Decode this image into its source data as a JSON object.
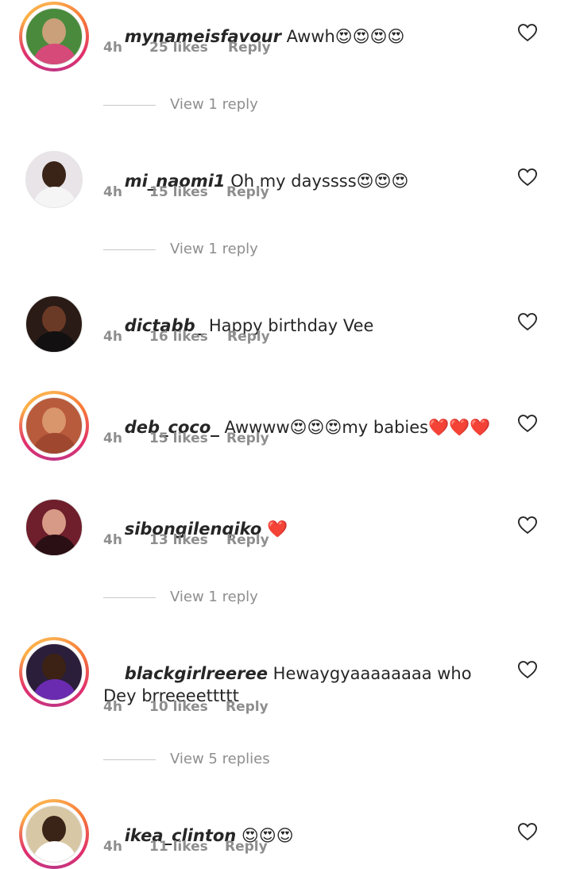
{
  "comments": [
    {
      "username": "mynameisfavour",
      "text": " Awwh😍😍😍😍",
      "time": "4h",
      "likes": "25 likes",
      "reply": "Reply",
      "story_ring": true,
      "avatar_colors": [
        "#4a8a3c",
        "#c9a07a",
        "#d64a7a"
      ],
      "replies_label": "View 1 reply"
    },
    {
      "username": "mi_naomi1",
      "text": " Oh my dayssss😍😍😍",
      "time": "4h",
      "likes": "15 likes",
      "reply": "Reply",
      "story_ring": false,
      "avatar_colors": [
        "#e9e4e7",
        "#3a2418",
        "#f5f5f5"
      ],
      "replies_label": "View 1 reply"
    },
    {
      "username": "dictabb_",
      "text": " Happy birthday Vee",
      "time": "4h",
      "likes": "16 likes",
      "reply": "Reply",
      "story_ring": false,
      "avatar_colors": [
        "#2a1b16",
        "#6b3a26",
        "#121010"
      ],
      "replies_label": ""
    },
    {
      "username": "deb_coco_",
      "text": " Awwww😍😍😍my babies❤️❤️❤️",
      "time": "4h",
      "likes": "15 likes",
      "reply": "Reply",
      "story_ring": true,
      "avatar_colors": [
        "#b85a3c",
        "#d9956b",
        "#a04730"
      ],
      "replies_label": ""
    },
    {
      "username": "sibongilenqiko",
      "text": " ❤️",
      "time": "4h",
      "likes": "13 likes",
      "reply": "Reply",
      "story_ring": false,
      "avatar_colors": [
        "#6e1f2b",
        "#d79a86",
        "#2a0f14"
      ],
      "replies_label": "View 1 reply"
    },
    {
      "username": "blackgirlreeree",
      "text": " Hewaygyaaaaaaaa who Dey brreeeettttt",
      "time": "4h",
      "likes": "10 likes",
      "reply": "Reply",
      "story_ring": true,
      "avatar_colors": [
        "#2b1e3a",
        "#3b2214",
        "#6a2bb0"
      ],
      "replies_label": "View 5 replies"
    },
    {
      "username": "ikea_clinton",
      "text": " 😍😍😍",
      "time": "4h",
      "likes": "11 likes",
      "reply": "Reply",
      "story_ring": true,
      "avatar_colors": [
        "#d8c7a4",
        "#3a2418",
        "#ffffff"
      ],
      "replies_label": ""
    }
  ],
  "icons": {
    "like": "heart-outline-icon"
  }
}
